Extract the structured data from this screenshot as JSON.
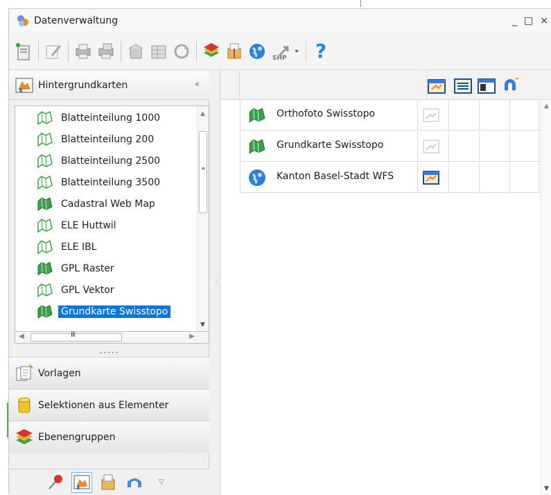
{
  "window": {
    "title": "Datenverwaltung",
    "minimize": "_",
    "maximize": "□",
    "close": "×"
  },
  "toolbar": {
    "buttons": [
      "new-document-icon",
      "edit-icon",
      "print-icon",
      "print-setup-icon",
      "export-icon",
      "table-export-icon",
      "refresh-icon",
      "add-layer-icon",
      "package-icon",
      "globe-icon",
      "shp-import-icon",
      "help-icon"
    ],
    "shp_label": "SHP",
    "help_label": "?"
  },
  "left_panel": {
    "header": "Hintergrundkarten",
    "collapse": "«",
    "items": [
      {
        "label": "Blatteinteilung 1000",
        "icon": "map-outline-icon"
      },
      {
        "label": "Blatteinteilung 200",
        "icon": "map-outline-icon"
      },
      {
        "label": "Blatteinteilung 2500",
        "icon": "map-outline-icon"
      },
      {
        "label": "Blatteinteilung 3500",
        "icon": "map-outline-icon"
      },
      {
        "label": "Cadastral Web Map",
        "icon": "map-green-icon"
      },
      {
        "label": "ELE Huttwil",
        "icon": "map-outline-icon"
      },
      {
        "label": "ELE IBL",
        "icon": "map-outline-icon"
      },
      {
        "label": "GPL Raster",
        "icon": "map-green-icon"
      },
      {
        "label": "GPL Vektor",
        "icon": "map-outline-icon"
      },
      {
        "label": "Grundkarte Swisstopo",
        "icon": "map-green-icon",
        "selected": true
      }
    ],
    "hscroll_grip": "III",
    "sections": [
      {
        "label": "Vorlagen"
      },
      {
        "label": "Selektionen aus Elementer"
      },
      {
        "label": "Ebenengruppen"
      }
    ]
  },
  "grid": {
    "rows": [
      {
        "label": "Orthofoto Swisstopo",
        "icon": "map-green-icon"
      },
      {
        "label": "Grundkarte Swisstopo",
        "icon": "map-green-icon"
      },
      {
        "label": "Kanton Basel-Stadt WFS",
        "icon": "globe-icon"
      }
    ]
  },
  "colors": {
    "selection": "#0a77d8",
    "map_green": "#3aa34a"
  }
}
